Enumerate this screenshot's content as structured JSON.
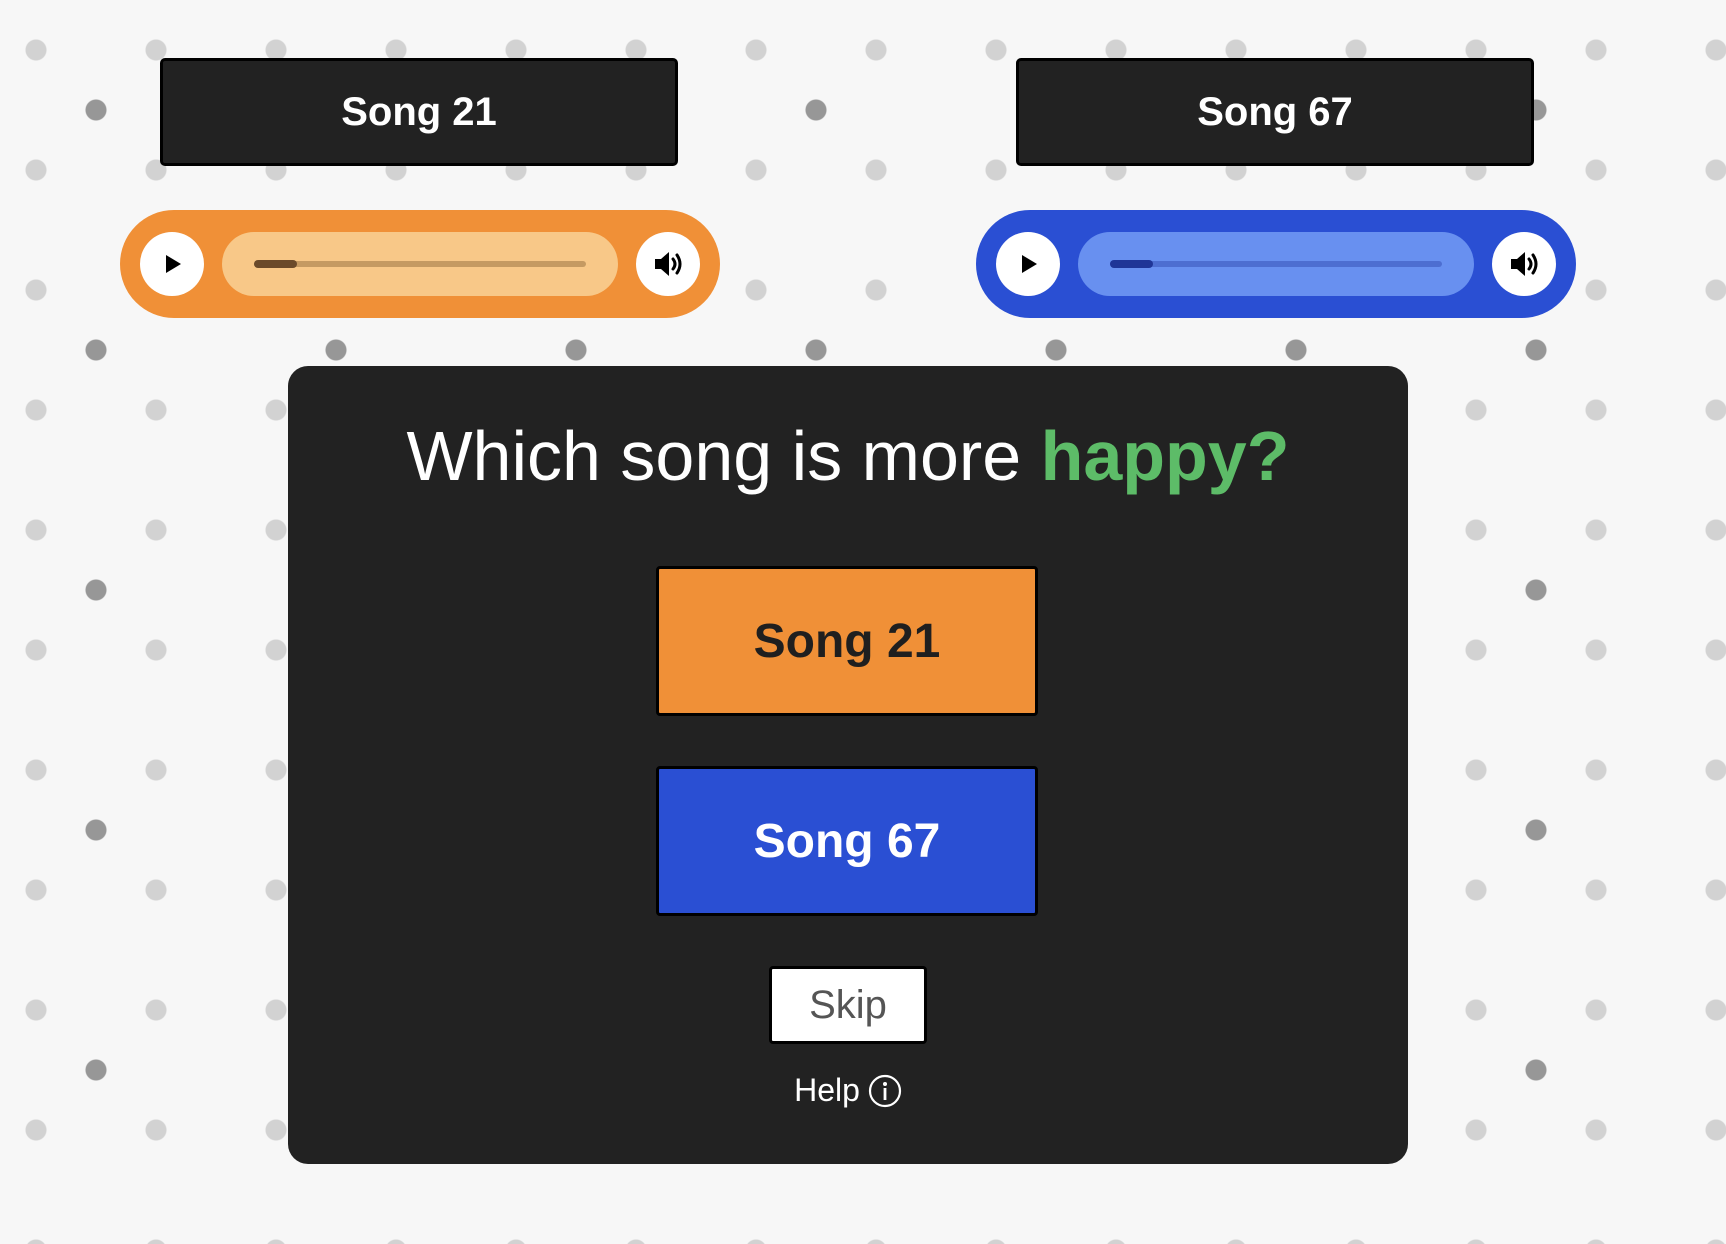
{
  "songs": {
    "left": {
      "title": "Song 21",
      "color": "#f09037",
      "progress": 0.13,
      "play_icon": "play-icon",
      "volume_icon": "volume-icon"
    },
    "right": {
      "title": "Song 67",
      "color": "#2a4fd3",
      "progress": 0.13,
      "play_icon": "play-icon",
      "volume_icon": "volume-icon"
    }
  },
  "question": {
    "prefix": "Which song is more",
    "attribute": "happy?",
    "attribute_color": "#5dbc68"
  },
  "choices": {
    "a_label": "Song 21",
    "b_label": "Song 67"
  },
  "actions": {
    "skip_label": "Skip",
    "help_label": "Help",
    "help_icon": "info-icon"
  }
}
